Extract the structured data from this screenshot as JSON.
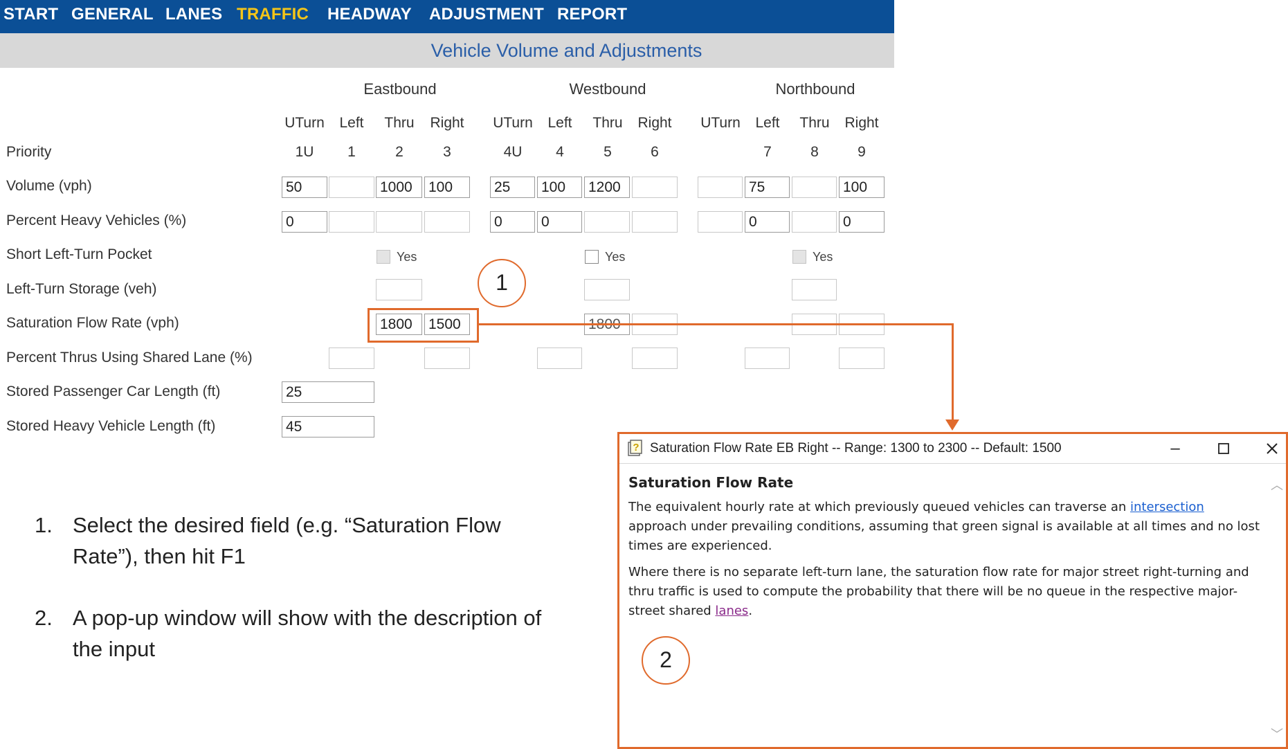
{
  "nav": {
    "tabs": [
      {
        "label": "START"
      },
      {
        "label": "GENERAL"
      },
      {
        "label": "LANES"
      },
      {
        "label": "TRAFFIC",
        "active": true
      },
      {
        "label": "HEADWAY"
      },
      {
        "label": "ADJUSTMENT"
      },
      {
        "label": "REPORT"
      }
    ],
    "active_color": "#f5c518",
    "bar_color": "#0b4f96"
  },
  "section_title": "Vehicle Volume and Adjustments",
  "groups": [
    "Eastbound",
    "Westbound",
    "Northbound"
  ],
  "columns": [
    "UTurn",
    "Left",
    "Thru",
    "Right",
    "UTurn",
    "Left",
    "Thru",
    "Right",
    "UTurn",
    "Left",
    "Thru",
    "Right"
  ],
  "priority": {
    "label": "Priority",
    "values": [
      "1U",
      "1",
      "2",
      "3",
      "4U",
      "4",
      "5",
      "6",
      "",
      "7",
      "8",
      "9"
    ]
  },
  "rows": {
    "volume": {
      "label": "Volume (vph)",
      "values": [
        "50",
        "",
        "1000",
        "100",
        "25",
        "100",
        "1200",
        "",
        "",
        "75",
        "",
        "100"
      ]
    },
    "heavy": {
      "label": "Percent Heavy Vehicles (%)",
      "values": [
        "0",
        "",
        "",
        "",
        "0",
        "0",
        "",
        "",
        "",
        "0",
        "",
        "0"
      ]
    },
    "pocket": {
      "label": "Short Left-Turn Pocket",
      "yes": "Yes"
    },
    "storage": {
      "label": "Left-Turn Storage (veh)"
    },
    "sat": {
      "label": "Saturation Flow Rate (vph)",
      "eb_thru": "1800",
      "eb_right": "1500",
      "wb_thru": "1800"
    },
    "shared": {
      "label": "Percent Thrus Using Shared Lane (%)"
    },
    "car_len": {
      "label": "Stored Passenger Car Length (ft)",
      "value": "25"
    },
    "hv_len": {
      "label": "Stored Heavy Vehicle Length (ft)",
      "value": "45"
    }
  },
  "callouts": {
    "one": "1",
    "two": "2",
    "accent": "#e06a2c"
  },
  "popup": {
    "title": "Saturation Flow Rate EB Right -- Range: 1300 to 2300 -- Default: 1500",
    "heading": "Saturation Flow Rate",
    "p1_a": "The equivalent hourly rate at which previously queued vehicles can traverse an ",
    "p1_link": "intersection",
    "p1_b": " approach under prevailing conditions, assuming that green signal is available at all times and no lost times are experienced.",
    "p2_a": "Where there is no separate left-turn lane, the saturation flow rate for major street right-turning and thru traffic is used to compute the probability that there will be no queue in the respective major-street shared ",
    "p2_link": "lanes",
    "p2_b": ".",
    "icon": "help-icon"
  },
  "instructions": [
    {
      "num": "1.",
      "text": "Select the desired field (e.g. “Saturation Flow Rate”), then hit F1"
    },
    {
      "num": "2.",
      "text": "A pop-up window will show with the description of the input"
    }
  ]
}
